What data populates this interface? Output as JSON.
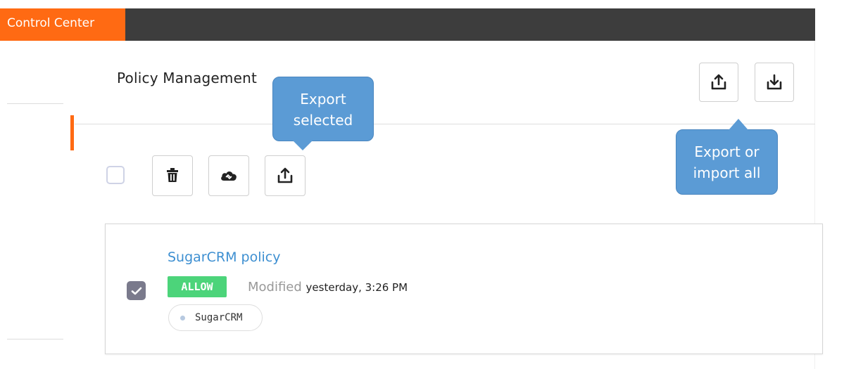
{
  "app": {
    "title": "Control Center"
  },
  "page": {
    "title": "Policy Management"
  },
  "header_actions": {
    "export_all_label": "Export all",
    "import_all_label": "Import all"
  },
  "toolbar": {
    "select_all_label": "Select all",
    "delete_label": "Delete",
    "deploy_label": "Deploy",
    "export_selected_label": "Export selected"
  },
  "tooltips": {
    "export_selected": [
      "Export",
      "selected"
    ],
    "export_import_all": [
      "Export or",
      "import all"
    ]
  },
  "policies": [
    {
      "name": "SugarCRM policy",
      "action": "ALLOW",
      "modified_label": "Modified",
      "modified_time": "yesterday, 3:26 PM",
      "apps": [
        "SugarCRM"
      ],
      "selected": true
    }
  ],
  "colors": {
    "brand": "#ff6a13",
    "topbar": "#3d3d3d",
    "tooltip": "#5b9bd5",
    "allow": "#4cd47a",
    "link": "#3d8fd1"
  },
  "icons": {
    "export": "upload-icon",
    "import": "download-icon",
    "delete": "trash-icon",
    "deploy": "cloud-sync-icon",
    "checked": "checkmark-icon"
  }
}
